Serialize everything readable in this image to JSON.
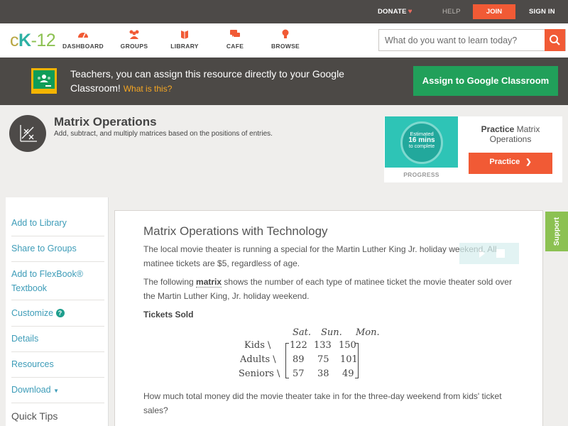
{
  "topbar": {
    "donate": "DONATE",
    "help": "HELP",
    "join": "JOIN",
    "signin": "SIGN IN"
  },
  "logo": {
    "c": "c",
    "k": "K",
    "n": "-12"
  },
  "nav": {
    "items": [
      {
        "label": "DASHBOARD",
        "icon": "dashboard-icon"
      },
      {
        "label": "GROUPS",
        "icon": "groups-icon"
      },
      {
        "label": "LIBRARY",
        "icon": "library-icon"
      },
      {
        "label": "CAFE",
        "icon": "cafe-icon"
      },
      {
        "label": "BROWSE",
        "icon": "browse-icon"
      }
    ],
    "search_placeholder": "What do you want to learn today?"
  },
  "classroom_banner": {
    "text": "Teachers, you can assign this resource directly to your Google Classroom!",
    "what_link": "What is this?",
    "button": "Assign to Google Classroom"
  },
  "concept": {
    "title": "Matrix Operations",
    "description": "Add, subtract, and multiply matrices based on the positions of entries."
  },
  "practice": {
    "estimated": "Estimated",
    "mins": "16 mins",
    "to_complete": "to complete",
    "progress_label": "PROGRESS",
    "title_bold": "Practice",
    "title_rest": " Matrix Operations",
    "button": "Practice"
  },
  "sidebar": {
    "items": [
      {
        "label": "Add to Library"
      },
      {
        "label": "Share to Groups"
      },
      {
        "label": "Add to FlexBook® Textbook"
      },
      {
        "label": "Customize"
      },
      {
        "label": "Details"
      },
      {
        "label": "Resources"
      },
      {
        "label": "Download"
      }
    ],
    "quick_tips": "Quick Tips"
  },
  "article": {
    "title": "Matrix Operations with Technology",
    "p1": "The local movie theater is running a special for the Martin Luther King Jr. holiday weekend. All matinee tickets are $5, regardless of age.",
    "p2_before": "The following ",
    "p2_term": "matrix",
    "p2_after": " shows the number of each type of matinee ticket the movie theater sold over the Martin Luther King, Jr. holiday weekend.",
    "tickets_label": "Tickets Sold",
    "matrix": {
      "columns": [
        "Sat.",
        "Sun.",
        "Mon."
      ],
      "rows": [
        {
          "label": "Kids \\",
          "values": [
            "122",
            "133",
            "150"
          ]
        },
        {
          "label": "Adults \\",
          "values": [
            "89",
            "75",
            "101"
          ]
        },
        {
          "label": "Seniors \\",
          "values": [
            "57",
            "38",
            "49"
          ]
        }
      ]
    },
    "question": "How much total money did the movie theater take in for the three-day weekend from kids' ticket sales?"
  },
  "support": "Support",
  "colors": {
    "accent": "#f15a35",
    "google_green": "#21a05a",
    "link": "#3d9cb8",
    "support_green": "#8cc152"
  }
}
